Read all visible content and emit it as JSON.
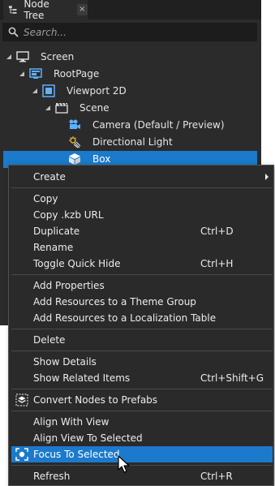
{
  "panel": {
    "tab_title": "Node Tree",
    "tab_close_glyph": "×",
    "search_placeholder": "Search..."
  },
  "tree": [
    {
      "label": "Screen",
      "icon": "screen-icon",
      "expanded": true
    },
    {
      "label": "RootPage",
      "icon": "page-icon",
      "expanded": true
    },
    {
      "label": "Viewport 2D",
      "icon": "viewport-icon",
      "expanded": true
    },
    {
      "label": "Scene",
      "icon": "scene-icon",
      "expanded": true
    },
    {
      "label": "Camera (Default / Preview)",
      "icon": "camera-icon"
    },
    {
      "label": "Directional Light",
      "icon": "light-icon"
    },
    {
      "label": "Box",
      "icon": "box-icon",
      "selected": true
    }
  ],
  "context_menu": {
    "items": [
      {
        "label": "Create",
        "submenu": true
      },
      {
        "label": "Copy"
      },
      {
        "label": "Copy .kzb URL"
      },
      {
        "label": "Duplicate",
        "shortcut": "Ctrl+D"
      },
      {
        "label": "Rename"
      },
      {
        "label": "Toggle Quick Hide",
        "shortcut": "Ctrl+H"
      },
      {
        "label": "Add Properties"
      },
      {
        "label": "Add Resources to a Theme Group"
      },
      {
        "label": "Add Resources to a Localization Table"
      },
      {
        "label": "Delete"
      },
      {
        "label": "Show Details"
      },
      {
        "label": "Show Related Items",
        "shortcut": "Ctrl+Shift+G"
      },
      {
        "label": "Convert Nodes to Prefabs",
        "icon": "prefab-icon"
      },
      {
        "label": "Align With View"
      },
      {
        "label": "Align View To Selected"
      },
      {
        "label": "Focus To Selected",
        "icon": "focus-icon",
        "highlighted": true
      },
      {
        "label": "Refresh",
        "shortcut": "Ctrl+R"
      }
    ]
  },
  "colors": {
    "panel_bg": "#2b2b2b",
    "selection": "#1b7acb",
    "menu_bg": "#2a2a2a"
  }
}
